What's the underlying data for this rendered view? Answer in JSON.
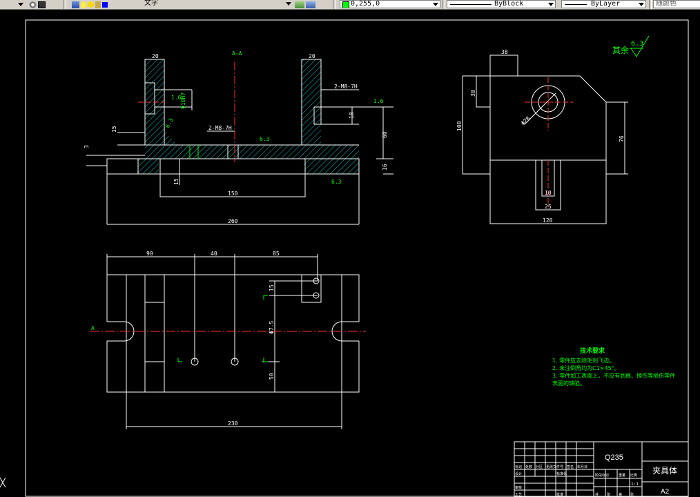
{
  "toolbar": {
    "layer_name": "文字",
    "color_label": "0,255,0",
    "linetype_label": "ByBlock",
    "lineweight_label": "ByLayer",
    "plotstyle_label": "随颜色"
  },
  "drawing": {
    "roughness_note": "其余",
    "roughness_value": "6.3",
    "front_view": {
      "section_label": "A-A",
      "dims": [
        "20",
        "20",
        "150",
        "260",
        "15",
        "3",
        "16",
        "60",
        "18",
        "15"
      ],
      "hole_notes": [
        "2-M8-7H",
        "2-M8-7H"
      ],
      "roughness": [
        "1.6",
        "6.3",
        "6.3",
        "1.6",
        "6.3"
      ],
      "fit_label": "Φ10H7"
    },
    "side_view": {
      "dims": [
        "38",
        "30",
        "100",
        "76",
        "10",
        "25",
        "120"
      ],
      "hole_label": "Φ28"
    },
    "top_view": {
      "dims": [
        "90",
        "40",
        "85",
        "15",
        "Φ7.5",
        "50",
        "230"
      ],
      "section_marker": "A"
    },
    "tech_req": {
      "title": "技术要求",
      "lines": [
        "1. 零件应去除毛刺飞边。",
        "2. 未注倒角均为C1×45°。",
        "3. 零件加工表面上，不应有划痕、擦伤等损伤零件",
        "表面的缺陷。"
      ]
    },
    "title_block": {
      "material": "Q235",
      "part_name": "夹具体",
      "sheet_size": "A2",
      "scale": "1:1",
      "row_labels": [
        "标记",
        "处数",
        "分区",
        "更改文件号",
        "签名",
        "年月日"
      ],
      "left_labels": [
        "设计",
        "审核",
        "工艺"
      ],
      "mid_labels": [
        "标准化",
        "批准"
      ],
      "stage_labels": [
        "阶段标记",
        "重量",
        "比例"
      ],
      "sheet_labels": [
        "共",
        "张",
        "第",
        "张"
      ]
    }
  }
}
